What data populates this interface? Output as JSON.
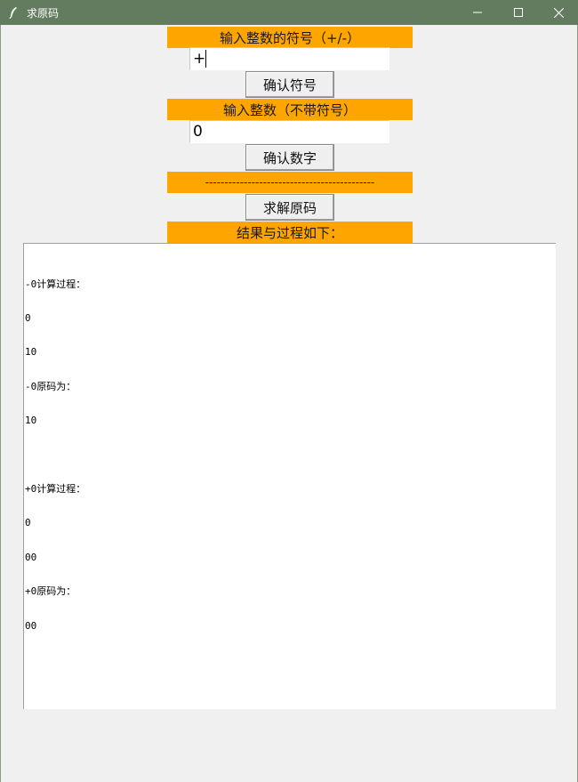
{
  "window": {
    "title": "求原码",
    "icon": "feather-icon",
    "controls": [
      "minimize-icon",
      "maximize-icon",
      "close-icon"
    ],
    "titlebar_color": "#637b5e"
  },
  "sign_section": {
    "label": "输入整数的符号（+/-）",
    "input_value": "+",
    "button_label": "确认符号"
  },
  "number_section": {
    "label": "输入整数（不带符号）",
    "input_value": "0",
    "button_label": "确认数字"
  },
  "separator": {
    "text": "--------------------------------------------"
  },
  "solve_button_label": "求解原码",
  "result_header": "结果与过程如下：",
  "output_lines": [
    "-0计算过程：",
    "0",
    "10",
    "-0原码为：",
    "10",
    "",
    "+0计算过程：",
    "0",
    "00",
    "+0原码为：",
    "00"
  ],
  "accent_color": "#ffa500"
}
